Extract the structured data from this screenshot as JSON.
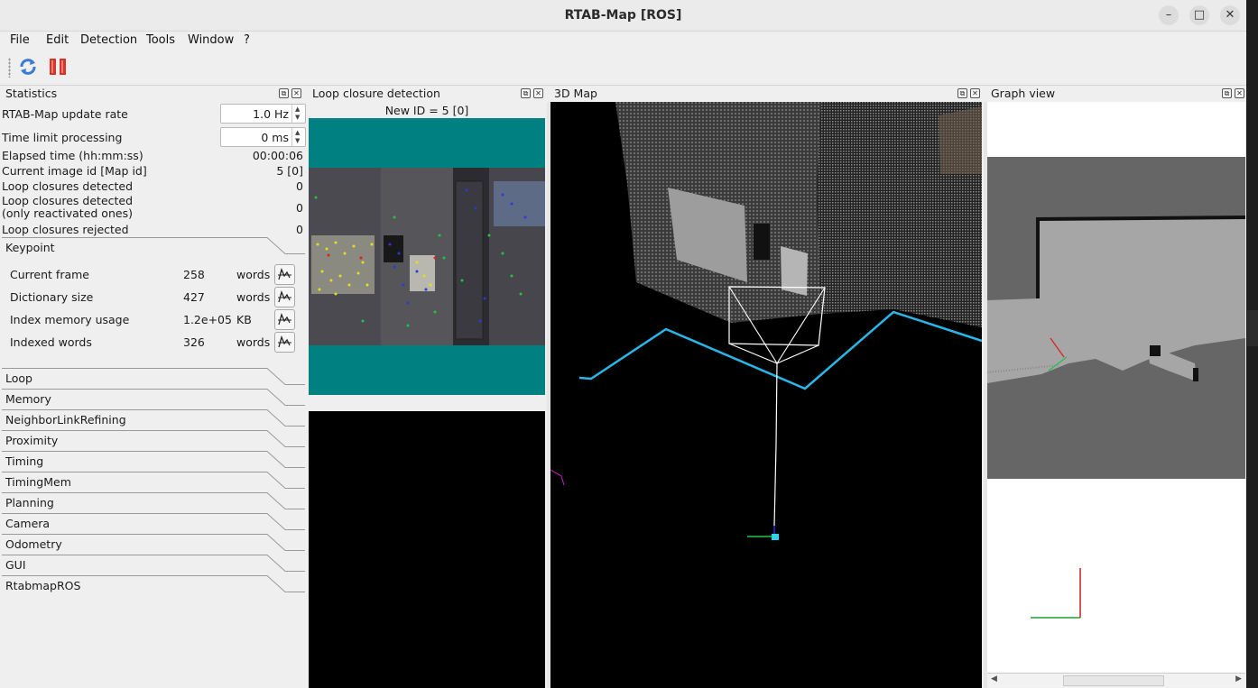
{
  "window": {
    "title": "RTAB-Map [ROS]",
    "minimize": "–",
    "maximize": "□",
    "close": "✕"
  },
  "menu": [
    "File",
    "Edit",
    "Detection",
    "Tools",
    "Window",
    "?"
  ],
  "toolbar": {
    "refresh_icon": "refresh-icon",
    "pause_icon": "pause-icon"
  },
  "docks": {
    "statistics": "Statistics",
    "loop": "Loop closure detection",
    "map3d": "3D Map",
    "graph": "Graph view",
    "float_glyph": "⧉",
    "close_glyph": "✕"
  },
  "statistics": {
    "update_rate": {
      "label": "RTAB-Map update rate",
      "value": "1.0 Hz"
    },
    "time_limit": {
      "label": "Time limit processing",
      "value": "0 ms"
    },
    "rows": [
      {
        "label": "Elapsed time (hh:mm:ss)",
        "value": "00:00:06"
      },
      {
        "label": "Current image id [Map id]",
        "value": "5 [0]"
      },
      {
        "label": "Loop closures detected",
        "value": "0"
      },
      {
        "label": "Loop closures detected\n(only reactivated ones)",
        "value": "0"
      },
      {
        "label": "Loop closures rejected",
        "value": "0"
      }
    ],
    "keypoint_group": "Keypoint",
    "keypoint_rows": [
      {
        "label": "Current frame",
        "value": "258",
        "unit": "words"
      },
      {
        "label": "Dictionary size",
        "value": "427",
        "unit": "words"
      },
      {
        "label": "Index memory usage",
        "value": "1.2e+05",
        "unit": "KB"
      },
      {
        "label": "Indexed words",
        "value": "326",
        "unit": "words"
      }
    ],
    "groups": [
      "Loop",
      "Memory",
      "NeighborLinkRefining",
      "Proximity",
      "Timing",
      "TimingMem",
      "Planning",
      "Camera",
      "Odometry",
      "GUI",
      "RtabmapROS"
    ]
  },
  "loop": {
    "new_id": "New ID = 5 [0]"
  },
  "colors": {
    "teal": "#008080",
    "path": "#29b6e8",
    "accent": "#3a7bd5",
    "pause": "#d8342c"
  }
}
